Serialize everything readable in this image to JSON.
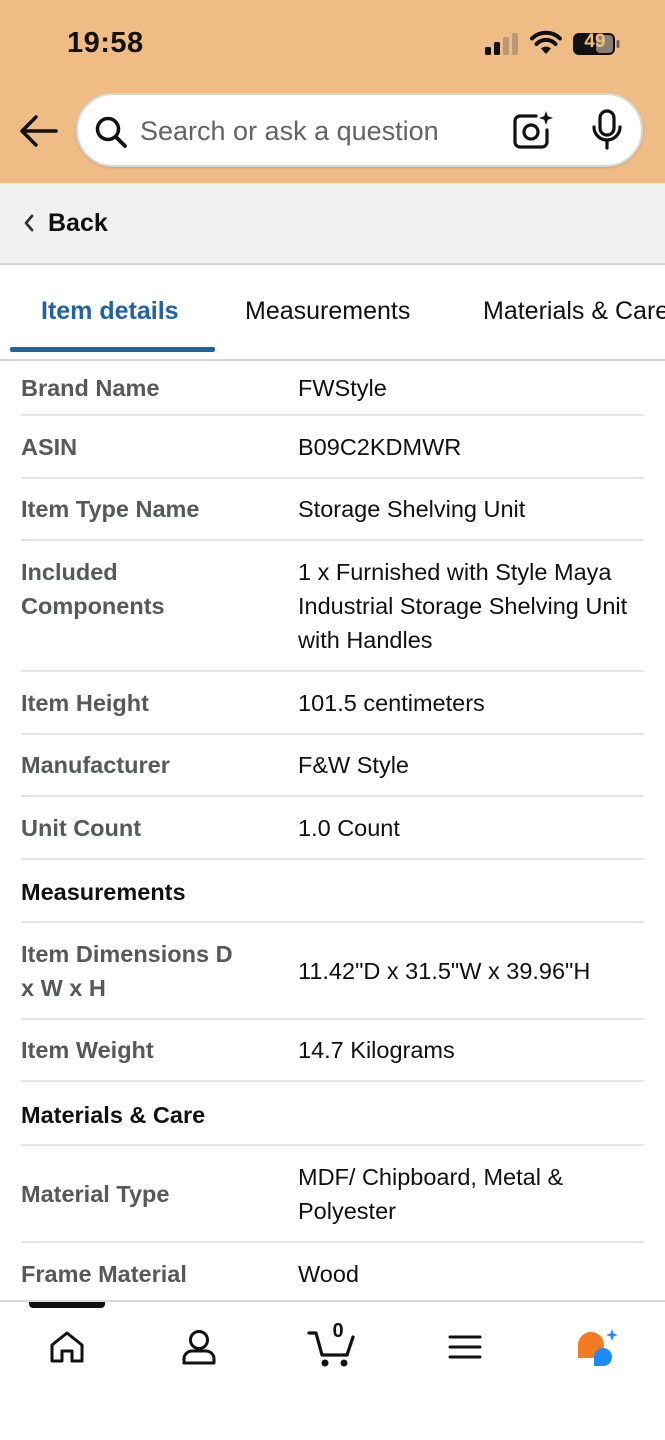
{
  "status_bar": {
    "time": "19:58",
    "battery": "49"
  },
  "search": {
    "placeholder": "Search or ask a question"
  },
  "back": {
    "label": "Back"
  },
  "tabs": [
    {
      "label": "Item details",
      "active": true
    },
    {
      "label": "Measurements",
      "active": false
    },
    {
      "label": "Materials & Care",
      "active": false
    }
  ],
  "details": {
    "brand_name": {
      "label": "Brand Name",
      "value": "FWStyle"
    },
    "asin": {
      "label": "ASIN",
      "value": "B09C2KDMWR"
    },
    "item_type_name": {
      "label": "Item Type Name",
      "value": "Storage Shelving Unit"
    },
    "included_components": {
      "label": "Included Components",
      "value": "1 x Furnished with Style Maya Industrial Storage Shelving Unit with Handles"
    },
    "item_height": {
      "label": "Item Height",
      "value": "101.5 centimeters"
    },
    "manufacturer": {
      "label": "Manufacturer",
      "value": "F&W Style"
    },
    "unit_count": {
      "label": "Unit Count",
      "value": "1.0 Count"
    }
  },
  "measurements": {
    "heading": "Measurements",
    "item_dimensions": {
      "label": "Item Dimensions D x W x H",
      "value": "11.42\"D x 31.5\"W x 39.96\"H"
    },
    "item_weight": {
      "label": "Item Weight",
      "value": "14.7 Kilograms"
    }
  },
  "materials": {
    "heading": "Materials & Care",
    "material_type": {
      "label": "Material Type",
      "value": "MDF/ Chipboard, Metal & Polyester"
    },
    "frame_material": {
      "label": "Frame Material",
      "value": "Wood"
    }
  },
  "bottom_nav": {
    "items": [
      "home-icon",
      "account-icon",
      "cart-icon",
      "menu-icon",
      "rufus-icon"
    ],
    "cart_count": "0"
  },
  "colors": {
    "header_bg": "#efbc85",
    "accent_blue": "#2162a1",
    "rufus_orange": "#f47b20",
    "rufus_blue": "#1a8cff"
  }
}
